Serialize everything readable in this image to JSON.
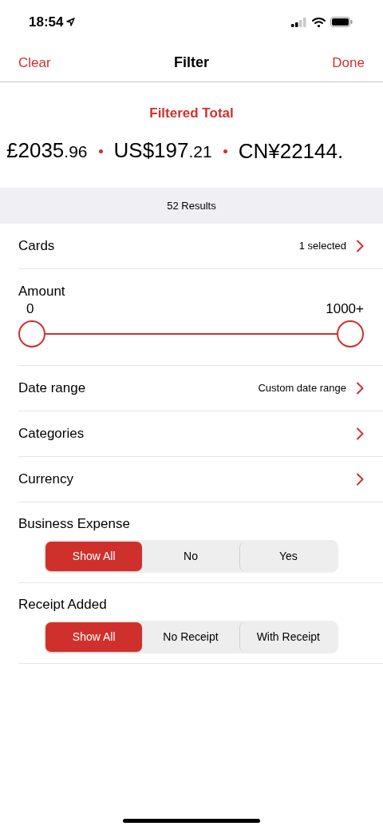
{
  "status_bar": {
    "time": "18:54"
  },
  "nav": {
    "left": "Clear",
    "title": "Filter",
    "right": "Done"
  },
  "total": {
    "title": "Filtered Total",
    "amounts": [
      {
        "main": "£2035",
        "cents": ".96"
      },
      {
        "main": "US$197",
        "cents": ".21"
      },
      {
        "main": "CN¥22144."
      }
    ]
  },
  "results": "52 Results",
  "rows": [
    {
      "kind": "nav",
      "label": "Cards",
      "value": "1 selected"
    },
    {
      "kind": "slider",
      "label": "Amount",
      "thumbs": [
        {
          "label": "0",
          "level": 0
        },
        {
          "label": "1000+",
          "level": 1
        }
      ]
    },
    {
      "kind": "nav",
      "label": "Date range",
      "value": "Custom date range"
    },
    {
      "kind": "nav",
      "label": "Categories"
    },
    {
      "kind": "nav",
      "label": "Currency"
    },
    {
      "kind": "segmented",
      "label": "Business Expense",
      "options": [
        {
          "label": "Show All",
          "selected": true
        },
        {
          "label": "No",
          "selected": false
        },
        {
          "label": "Yes",
          "selected": false
        }
      ]
    },
    {
      "kind": "segmented",
      "label": "Receipt Added",
      "options": [
        {
          "label": "Show All",
          "selected": true
        },
        {
          "label": "No Receipt",
          "selected": false
        },
        {
          "label": "With Receipt",
          "selected": false
        }
      ]
    }
  ]
}
